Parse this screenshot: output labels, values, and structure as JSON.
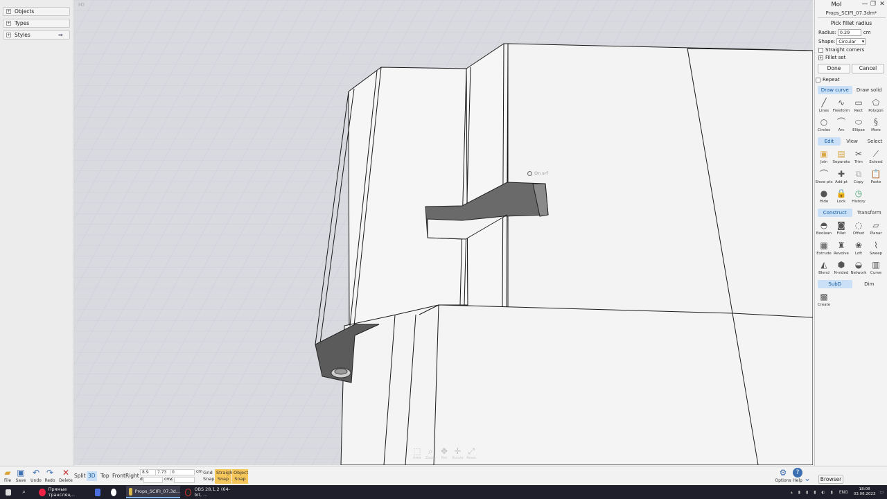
{
  "left_panel": {
    "items": [
      {
        "label": "Objects"
      },
      {
        "label": "Types"
      },
      {
        "label": "Styles"
      }
    ]
  },
  "viewport": {
    "label": "3D",
    "osnap_hint": "On srf",
    "nav_buttons": [
      {
        "label": "Area"
      },
      {
        "label": "Zoom"
      },
      {
        "label": "Pan"
      },
      {
        "label": "Rotate"
      },
      {
        "label": "Reset"
      }
    ]
  },
  "right_panel": {
    "app_title": "MoI",
    "file_name": "Props_SCIFI_07.3dm*",
    "command": {
      "title": "Pick fillet radius",
      "radius_label": "Radius:",
      "radius_value": "0.29",
      "radius_unit": "cm",
      "shape_label": "Shape:",
      "shape_value": "Circular",
      "straight_corners": "Straight corners",
      "fillet_set": "Fillet set",
      "done": "Done",
      "cancel": "Cancel",
      "repeat": "Repeat"
    },
    "draw_tabs": [
      {
        "label": "Draw curve"
      },
      {
        "label": "Draw solid"
      }
    ],
    "draw_tools": [
      {
        "label": "Lines"
      },
      {
        "label": "Freeform"
      },
      {
        "label": "Rect"
      },
      {
        "label": "Polygon"
      },
      {
        "label": "Circles"
      },
      {
        "label": "Arc"
      },
      {
        "label": "Ellipse"
      },
      {
        "label": "More"
      }
    ],
    "edit_tabs": [
      {
        "label": "Edit"
      },
      {
        "label": "View"
      },
      {
        "label": "Select"
      }
    ],
    "edit_tools": [
      {
        "label": "Join"
      },
      {
        "label": "Separate"
      },
      {
        "label": "Trim"
      },
      {
        "label": "Extend"
      },
      {
        "label": "Show pts"
      },
      {
        "label": "Add pt"
      },
      {
        "label": "Copy"
      },
      {
        "label": "Paste"
      },
      {
        "label": "Hide"
      },
      {
        "label": "Lock"
      },
      {
        "label": "History"
      }
    ],
    "construct_tabs": [
      {
        "label": "Construct"
      },
      {
        "label": "Transform"
      }
    ],
    "construct_tools": [
      {
        "label": "Boolean"
      },
      {
        "label": "Fillet"
      },
      {
        "label": "Offset"
      },
      {
        "label": "Planar"
      },
      {
        "label": "Extrude"
      },
      {
        "label": "Revolve"
      },
      {
        "label": "Loft"
      },
      {
        "label": "Sweep"
      },
      {
        "label": "Blend"
      },
      {
        "label": "N-sided"
      },
      {
        "label": "Network"
      },
      {
        "label": "Curve"
      }
    ],
    "subd_tabs": [
      {
        "label": "SubD"
      },
      {
        "label": "Dim"
      }
    ],
    "subd_tools": [
      {
        "label": "Create"
      }
    ]
  },
  "bottom_bar": {
    "file_buttons": [
      {
        "label": "File"
      },
      {
        "label": "Save"
      },
      {
        "label": "Undo"
      },
      {
        "label": "Redo"
      },
      {
        "label": "Delete"
      }
    ],
    "views": [
      {
        "label": "Split"
      },
      {
        "label": "3D"
      },
      {
        "label": "Top"
      },
      {
        "label": "Front"
      },
      {
        "label": "Right"
      }
    ],
    "coords": {
      "x": "8.9",
      "y": "7.73",
      "z": "0",
      "unit": "cm",
      "d_label": "d",
      "d_unit": "cm",
      "angle_sym": "∠"
    },
    "snaps": {
      "grid": "Grid Snap",
      "straight": "Straight Snap",
      "object": "Object Snap"
    },
    "options": "Options",
    "help": "Help",
    "browser": "Browser"
  },
  "taskbar": {
    "apps": [
      {
        "label": "Прямые трансляц..."
      },
      {
        "label": "Props_SCIFI_07.3d..."
      },
      {
        "label": "OBS 28.1.2 (64-bit, ..."
      }
    ],
    "lang": "ENG",
    "time": "18:08",
    "date": "03.06.2023"
  }
}
